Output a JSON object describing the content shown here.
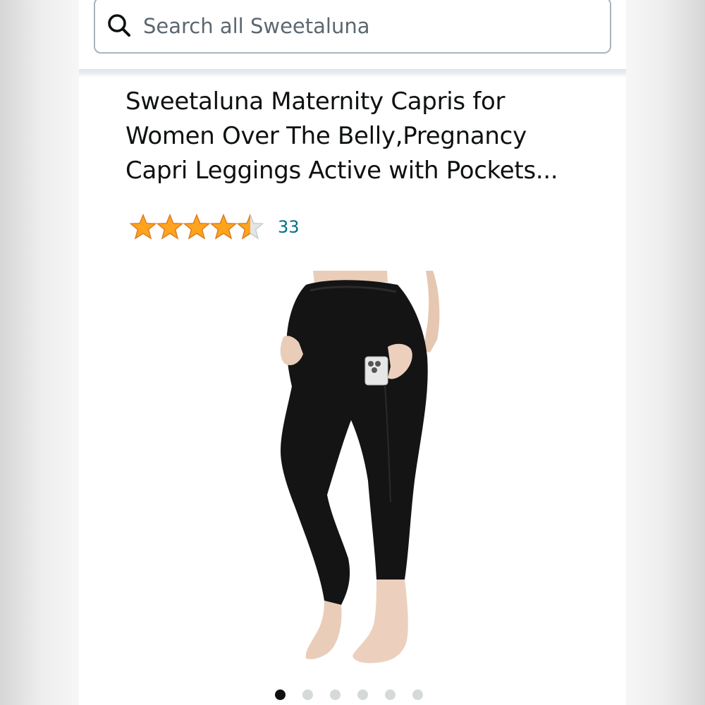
{
  "search": {
    "placeholder": "Search all Sweetaluna",
    "icon": "search-icon"
  },
  "product": {
    "title": "Sweetaluna Maternity Capris for Women Over The Belly,Pregnancy Capri Leggings Active with Pockets...",
    "rating": 4.5,
    "rating_max": 5,
    "review_count": "33",
    "image_description_icon": "product-photo"
  },
  "carousel": {
    "total": 6,
    "active_index": 0
  },
  "colors": {
    "star_fill": "#ffa41c",
    "star_empty": "#e3e6e6",
    "link": "#007185",
    "text": "#0f1111",
    "dot_active": "#0f1111",
    "dot_inactive": "#d5d9d9"
  }
}
